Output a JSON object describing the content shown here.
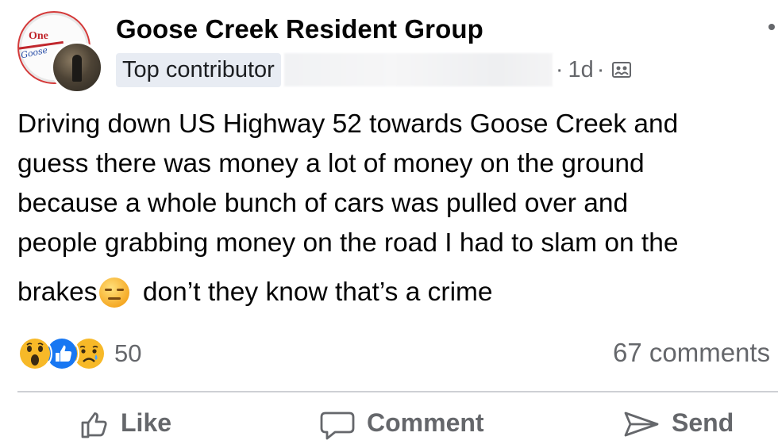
{
  "post": {
    "group_name": "Goose Creek Resident Group",
    "contributor_badge": "Top contributor",
    "time_prefix": "·",
    "time": "1d",
    "time_suffix": "·",
    "audience_icon": "group-audience-icon",
    "badge_logo_text": "One",
    "badge_logo_script": "Goose",
    "lines": [
      "Driving down US Highway 52 towards Goose Creek and",
      "guess there was money a lot of money on the ground",
      "because a whole bunch of cars was pulled over and",
      "people grabbing money on the road I had to slam on the"
    ],
    "last_line_before": "brakes",
    "last_line_emoji": "expressionless-face-emoji",
    "last_line_after": " don’t they know that’s a crime"
  },
  "reactions": {
    "icons": [
      "wow-reaction-icon",
      "like-reaction-icon",
      "sad-reaction-icon"
    ],
    "count": "50"
  },
  "comments": {
    "count_label": "67 comments"
  },
  "actions": {
    "like_label": "Like",
    "comment_label": "Comment",
    "send_label": "Send"
  },
  "colors": {
    "text": "#050505",
    "secondary": "#65676b",
    "like_blue": "#1877f2",
    "reaction_yellow": "#f7b928",
    "badge_bg": "#e8ecf3"
  }
}
